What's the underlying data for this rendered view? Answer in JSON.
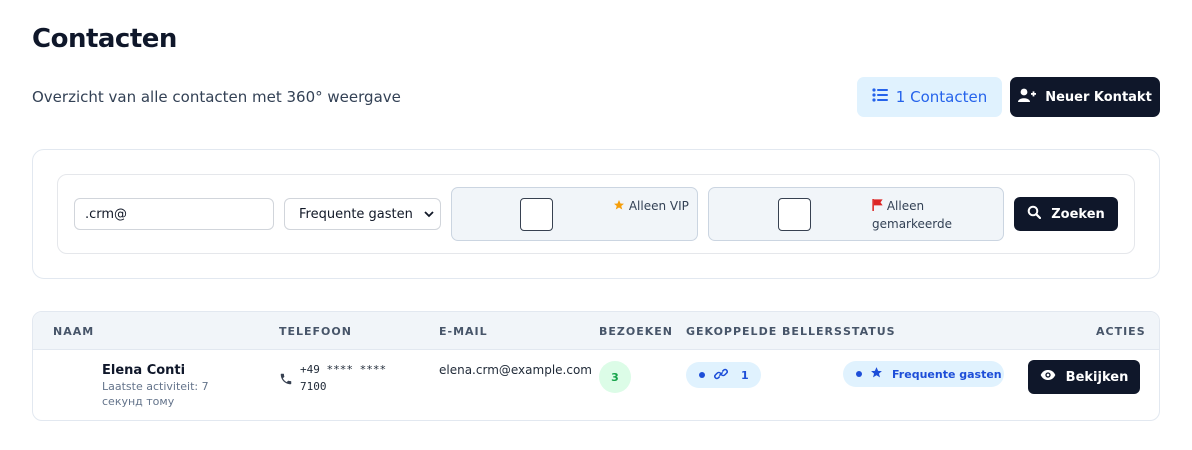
{
  "page": {
    "title": "Contacten",
    "subtitle": "Overzicht van alle contacten met 360° weergave"
  },
  "header_actions": {
    "count_label": "1 Contacten",
    "new_contact_label": "Neuer Kontakt"
  },
  "filters": {
    "search_value": ".crm@",
    "segment_selected": "Frequente gasten",
    "vip_label": "Alleen VIP",
    "flagged_label": "Alleen gemarkeerde",
    "search_button": "Zoeken"
  },
  "table": {
    "headers": {
      "name": "NAAM",
      "phone": "TELEFOON",
      "email": "E-MAIL",
      "visits": "BEZOEKEN",
      "callers": "GEKOPPELDE BELLERS",
      "status": "STATUS",
      "actions": "ACTIES"
    },
    "rows": [
      {
        "name": "Elena Conti",
        "activity": "Laatste activiteit: 7 секунд тому",
        "phone": "+49 **** **** 7100",
        "email": "elena.crm@example.com",
        "visits": "3",
        "linked_callers": "1",
        "status": "Frequente gasten",
        "action": "Bekijken"
      }
    ]
  },
  "colors": {
    "primary_dark": "#0f172a",
    "accent_blue": "#2563eb",
    "light_blue": "#e0f2fe",
    "visits_green": "#16a34a",
    "flag_red": "#dc2626",
    "star_gold": "#f59e0b"
  },
  "icons": {
    "count": "list-icon",
    "new_contact": "user-plus-icon",
    "vip": "star-icon",
    "flagged": "flag-icon",
    "search": "search-icon",
    "phone": "phone-icon",
    "link": "link-icon",
    "status": "star-icon",
    "view": "eye-icon"
  }
}
